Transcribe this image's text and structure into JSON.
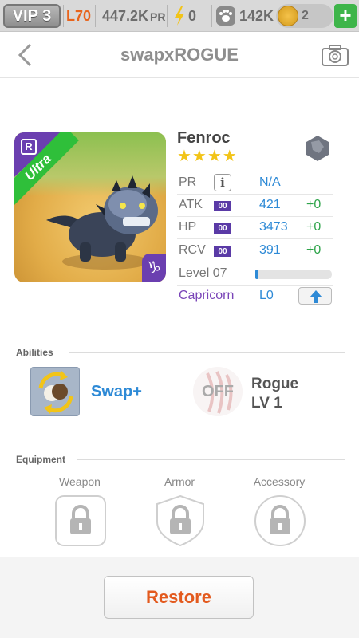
{
  "topbar": {
    "vip": "VIP 3",
    "level": "L70",
    "power": "447.2K",
    "power_unit": "PR",
    "energy": "0",
    "paws": "142K",
    "coins": "2",
    "add": "+",
    "colors": {
      "level": "#e8641c",
      "add": "#3eb54a"
    }
  },
  "header": {
    "title": "swapxROGUE"
  },
  "monster": {
    "name": "Fenroc",
    "stars": "★★★★",
    "star_count": 4,
    "rarity": "Ultra",
    "rarity_badge": "R",
    "sign_glyph": "♑",
    "element_icon": "stone-element-icon",
    "stats": {
      "pr_label": "PR",
      "pr_info": "i",
      "pr_value": "N/A",
      "atk_label": "ATK",
      "atk_badge": "00",
      "atk_value": "421",
      "atk_bonus": "+0",
      "hp_label": "HP",
      "hp_badge": "00",
      "hp_value": "3473",
      "hp_bonus": "+0",
      "rcv_label": "RCV",
      "rcv_badge": "00",
      "rcv_value": "391",
      "rcv_bonus": "+0"
    },
    "level": "Level 07",
    "xp_fraction": 0.02,
    "sign_name": "Capricorn",
    "sign_level": "L0"
  },
  "abilities": {
    "section_label": "Abilities",
    "ability1": {
      "name": "Swap+"
    },
    "ability2": {
      "status": "OFF",
      "name": "Rogue",
      "level": "LV 1"
    }
  },
  "equipment": {
    "section_label": "Equipment",
    "slots": [
      {
        "label": "Weapon"
      },
      {
        "label": "Armor"
      },
      {
        "label": "Accessory"
      }
    ]
  },
  "actions": {
    "restore": "Restore"
  }
}
